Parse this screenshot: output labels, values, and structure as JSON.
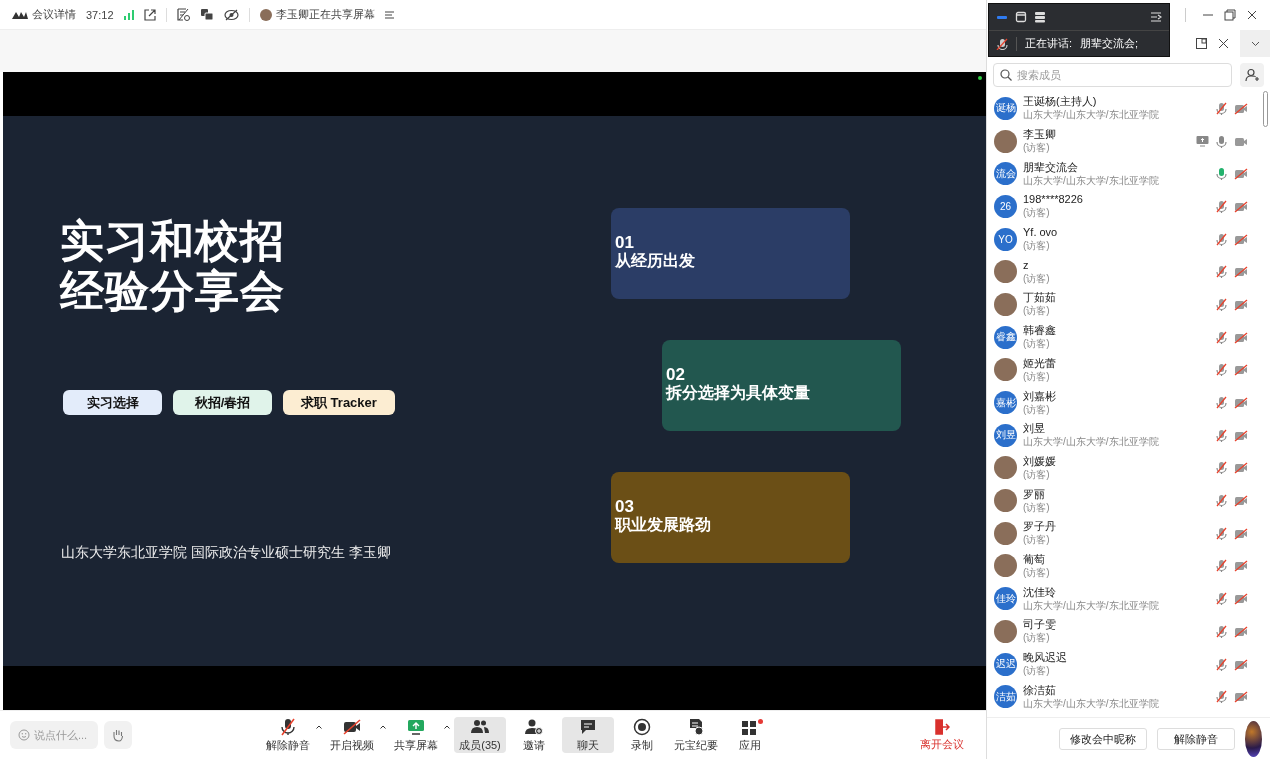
{
  "topbar": {
    "app_label": "会议详情",
    "timer": "37:12",
    "sharing_notice": "李玉卿正在共享屏幕"
  },
  "slide": {
    "title_lines": [
      "实习和校招",
      "经验分享会"
    ],
    "tags": [
      {
        "label": "实习选择",
        "color": "#e3ecfa"
      },
      {
        "label": "秋招/春招",
        "color": "#e0f3ea"
      },
      {
        "label": "求职 Tracker",
        "color": "#fcedd2"
      }
    ],
    "sections": [
      {
        "number": "01",
        "text": "从经历出发",
        "color": "#2b3d66"
      },
      {
        "number": "02",
        "text": "拆分选择为具体变量",
        "color": "#22574f"
      },
      {
        "number": "03",
        "text": "职业发展路劲",
        "color": "#6b4f16"
      }
    ],
    "footer": "山东大学东北亚学院 国际政治专业硕士研究生 李玉卿"
  },
  "toolbar": {
    "chat_placeholder": "说点什么...",
    "buttons": [
      {
        "label": "解除静音",
        "kind": "unmute",
        "caret": true,
        "selected": false
      },
      {
        "label": "开启视频",
        "kind": "video",
        "caret": true,
        "selected": false
      },
      {
        "label": "共享屏幕",
        "kind": "share",
        "caret": true,
        "selected": false
      },
      {
        "label": "成员(35)",
        "kind": "members",
        "caret": false,
        "selected": true
      },
      {
        "label": "邀请",
        "kind": "invite",
        "caret": false,
        "selected": false
      },
      {
        "label": "聊天",
        "kind": "chat",
        "caret": false,
        "selected": true
      },
      {
        "label": "录制",
        "kind": "record",
        "caret": false,
        "selected": false
      },
      {
        "label": "元宝纪要",
        "kind": "summary",
        "caret": false,
        "selected": false
      },
      {
        "label": "应用",
        "kind": "apps",
        "caret": false,
        "selected": false
      }
    ],
    "leave": "离开会议"
  },
  "speaker_widget": {
    "label": "正在讲话:",
    "name": "朋辈交流会;"
  },
  "members_panel": {
    "search_placeholder": "搜索成员",
    "members": [
      {
        "name": "王诞杨(主持人)",
        "detail": "山东大学/山东大学/东北亚学院",
        "photo": false,
        "initials": "诞杨",
        "mic_muted": true,
        "speaking": false,
        "camera_on": false,
        "sharing": false
      },
      {
        "name": "李玉卿",
        "detail": "(访客)",
        "photo": true,
        "mic_muted": false,
        "speaking": false,
        "camera_on": true,
        "sharing": true
      },
      {
        "name": "朋辈交流会",
        "detail": "山东大学/山东大学/东北亚学院",
        "photo": false,
        "initials": "流会",
        "mic_muted": false,
        "speaking": true,
        "camera_on": false,
        "sharing": false
      },
      {
        "name": "198****8226",
        "detail": "(访客)",
        "photo": false,
        "initials": "26",
        "mic_muted": true,
        "speaking": false,
        "camera_on": false,
        "sharing": false
      },
      {
        "name": "Yf. ovo",
        "detail": "(访客)",
        "photo": false,
        "initials": "YO",
        "mic_muted": true,
        "speaking": false,
        "camera_on": false,
        "sharing": false
      },
      {
        "name": "z",
        "detail": "(访客)",
        "photo": true,
        "mic_muted": true,
        "speaking": false,
        "camera_on": false,
        "sharing": false
      },
      {
        "name": "丁茹茹",
        "detail": "(访客)",
        "photo": true,
        "mic_muted": true,
        "speaking": false,
        "camera_on": false,
        "sharing": false
      },
      {
        "name": "韩睿鑫",
        "detail": "(访客)",
        "photo": false,
        "initials": "睿鑫",
        "mic_muted": true,
        "speaking": false,
        "camera_on": false,
        "sharing": false
      },
      {
        "name": "姬光蕾",
        "detail": "(访客)",
        "photo": true,
        "mic_muted": true,
        "speaking": false,
        "camera_on": false,
        "sharing": false
      },
      {
        "name": "刘嘉彬",
        "detail": "(访客)",
        "photo": false,
        "initials": "嘉彬",
        "mic_muted": true,
        "speaking": false,
        "camera_on": false,
        "sharing": false
      },
      {
        "name": "刘昱",
        "detail": "山东大学/山东大学/东北亚学院",
        "photo": false,
        "initials": "刘昱",
        "mic_muted": true,
        "speaking": false,
        "camera_on": false,
        "sharing": false
      },
      {
        "name": "刘媛媛",
        "detail": "(访客)",
        "photo": true,
        "mic_muted": true,
        "speaking": false,
        "camera_on": false,
        "sharing": false
      },
      {
        "name": "罗丽",
        "detail": "(访客)",
        "photo": true,
        "mic_muted": true,
        "speaking": false,
        "camera_on": false,
        "sharing": false
      },
      {
        "name": "罗子丹",
        "detail": "(访客)",
        "photo": true,
        "mic_muted": true,
        "speaking": false,
        "camera_on": false,
        "sharing": false
      },
      {
        "name": "葡萄",
        "detail": "(访客)",
        "photo": true,
        "mic_muted": true,
        "speaking": false,
        "camera_on": false,
        "sharing": false
      },
      {
        "name": "沈佳玲",
        "detail": "山东大学/山东大学/东北亚学院",
        "photo": false,
        "initials": "佳玲",
        "mic_muted": true,
        "speaking": false,
        "camera_on": false,
        "sharing": false
      },
      {
        "name": "司子雯",
        "detail": "(访客)",
        "photo": true,
        "mic_muted": true,
        "speaking": false,
        "camera_on": false,
        "sharing": false
      },
      {
        "name": "晚风迟迟",
        "detail": "(访客)",
        "photo": false,
        "initials": "迟迟",
        "mic_muted": true,
        "speaking": false,
        "camera_on": false,
        "sharing": false
      },
      {
        "name": "徐洁茹",
        "detail": "山东大学/山东大学/东北亚学院",
        "photo": false,
        "initials": "洁茹",
        "mic_muted": true,
        "speaking": false,
        "camera_on": false,
        "sharing": false
      }
    ],
    "buttons": [
      "修改会中昵称",
      "解除静音"
    ]
  }
}
